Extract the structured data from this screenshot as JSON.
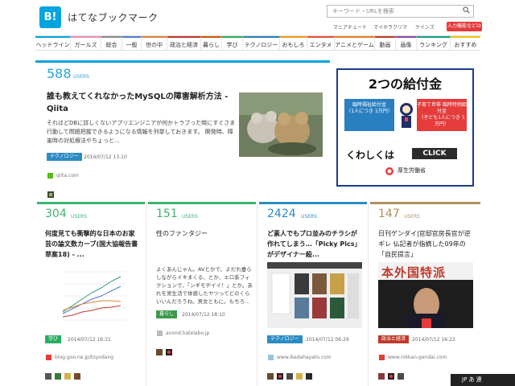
{
  "header": {
    "logo_mark": "B!",
    "logo_text": "はてなブックマーク",
    "search_placeholder": "キーワード・URLを検索",
    "sublinks": [
      "マニアチュード",
      "マイホラクリマ",
      "ケインズ"
    ],
    "register_button": "入力機能などは"
  },
  "nav": {
    "items": [
      {
        "label": "ヘッドライン",
        "color": "#00a4de"
      },
      {
        "label": "ガールズ",
        "color": "#f08ab6"
      },
      {
        "label": "総合",
        "color": "#888888"
      },
      {
        "label": "一般",
        "color": "#4f7bd1"
      },
      {
        "label": "世の中",
        "color": "#e0813b"
      },
      {
        "label": "政治と経済",
        "color": "#c0392b"
      },
      {
        "label": "暮らし",
        "color": "#d35400"
      },
      {
        "label": "学び",
        "color": "#27ae60"
      },
      {
        "label": "テクノロジー",
        "color": "#2980b9"
      },
      {
        "label": "おもしろ",
        "color": "#f39c12"
      },
      {
        "label": "エンタメ",
        "color": "#e74c3c"
      },
      {
        "label": "アニメとゲーム",
        "color": "#e67e22"
      },
      {
        "label": "動画",
        "color": "#c0392b"
      },
      {
        "label": "画像",
        "color": "#8e44ad"
      },
      {
        "label": "ランキング",
        "color": "#16a085"
      },
      {
        "label": "おすすめ",
        "color": "#f1c40f"
      }
    ]
  },
  "featured": {
    "count": "588",
    "users": "USERS",
    "title": "誰も教えてくれなかったMySQLの障害解析方法 - Qiita",
    "description": "それほどDBに詳しくないアプリエンジニアが何かトラブった時にすぐさま行動して問題把握できるようになる情報を列挙しておきます。 開発時、障害時の対処療法やちょっと...",
    "tag": "テクノロジー",
    "tag_color": "#2b8cc4",
    "date": "2014/07/12 13:10",
    "site": "qiita.com"
  },
  "ad": {
    "title": "2つの給付金",
    "box1": "臨時福祉給付金",
    "box1_sub": "（1人につき 1万円）",
    "box2": "子育て世帯 臨時特例給付金",
    "box2_sub": "（子ども1人につき 1万円）",
    "more": "くわしくは",
    "click": "CLICK",
    "ministry": "厚生労働省"
  },
  "cards": [
    {
      "count": "304",
      "users": "USERS",
      "color": "#3cb371",
      "title": "何度見ても衝撃的な日本のお家芸の論文数カーブ(国大協報告書草案18) - ...",
      "tag": "学び",
      "tag_color": "#27ae60",
      "date": "2014/07/12 16:31",
      "site": "blog.goo.ne.jp/toyodang"
    },
    {
      "count": "151",
      "users": "USERS",
      "color": "#3cb371",
      "title": "性のファンタジー",
      "text": "よくあんじゃん。AVとかで、よだれ垂らしながらイキまくる、とか、エロ系フィクションで、「ンギモヂイイ！」とか。あれを実生活で体感したヤツってどのくらいいんだろうね。男女ともに。もちろ...",
      "tag": "暮らし",
      "tag_color": "#3a9a4a",
      "date": "2014/07/12 18:10",
      "site": "anond.hatelabo.jp"
    },
    {
      "count": "2424",
      "users": "USERS",
      "color": "#2b8cc4",
      "title": "ど素人でもプロ並みのチラシが作れてしまう…「Picky Pics」がデザイナー殺...",
      "tag": "テクノロジー",
      "tag_color": "#2b8cc4",
      "date": "2014/07/12 06:29",
      "site": "www.ikedahayato.com"
    },
    {
      "count": "147",
      "users": "USERS",
      "color": "#b09060",
      "title": "日刊ゲンダイ|官邸官房長官が逆ギレ 仏記者が指摘した09年の「自民提言」",
      "image_text": "本外国特派",
      "tag": "政治と経済",
      "tag_color": "#c0392b",
      "date": "2014/07/12 16:22",
      "site": "www.nikkan-gendai.com"
    }
  ],
  "taskbar": {
    "text": "JP あ 連"
  }
}
